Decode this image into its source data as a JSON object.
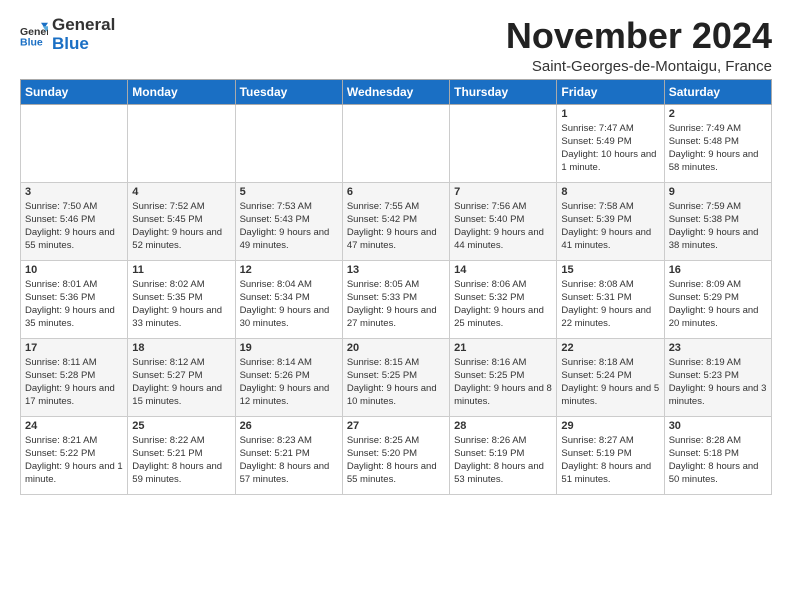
{
  "logo": {
    "general": "General",
    "blue": "Blue"
  },
  "title": "November 2024",
  "location": "Saint-Georges-de-Montaigu, France",
  "headers": [
    "Sunday",
    "Monday",
    "Tuesday",
    "Wednesday",
    "Thursday",
    "Friday",
    "Saturday"
  ],
  "weeks": [
    [
      {
        "day": "",
        "info": ""
      },
      {
        "day": "",
        "info": ""
      },
      {
        "day": "",
        "info": ""
      },
      {
        "day": "",
        "info": ""
      },
      {
        "day": "",
        "info": ""
      },
      {
        "day": "1",
        "info": "Sunrise: 7:47 AM\nSunset: 5:49 PM\nDaylight: 10 hours and 1 minute."
      },
      {
        "day": "2",
        "info": "Sunrise: 7:49 AM\nSunset: 5:48 PM\nDaylight: 9 hours and 58 minutes."
      }
    ],
    [
      {
        "day": "3",
        "info": "Sunrise: 7:50 AM\nSunset: 5:46 PM\nDaylight: 9 hours and 55 minutes."
      },
      {
        "day": "4",
        "info": "Sunrise: 7:52 AM\nSunset: 5:45 PM\nDaylight: 9 hours and 52 minutes."
      },
      {
        "day": "5",
        "info": "Sunrise: 7:53 AM\nSunset: 5:43 PM\nDaylight: 9 hours and 49 minutes."
      },
      {
        "day": "6",
        "info": "Sunrise: 7:55 AM\nSunset: 5:42 PM\nDaylight: 9 hours and 47 minutes."
      },
      {
        "day": "7",
        "info": "Sunrise: 7:56 AM\nSunset: 5:40 PM\nDaylight: 9 hours and 44 minutes."
      },
      {
        "day": "8",
        "info": "Sunrise: 7:58 AM\nSunset: 5:39 PM\nDaylight: 9 hours and 41 minutes."
      },
      {
        "day": "9",
        "info": "Sunrise: 7:59 AM\nSunset: 5:38 PM\nDaylight: 9 hours and 38 minutes."
      }
    ],
    [
      {
        "day": "10",
        "info": "Sunrise: 8:01 AM\nSunset: 5:36 PM\nDaylight: 9 hours and 35 minutes."
      },
      {
        "day": "11",
        "info": "Sunrise: 8:02 AM\nSunset: 5:35 PM\nDaylight: 9 hours and 33 minutes."
      },
      {
        "day": "12",
        "info": "Sunrise: 8:04 AM\nSunset: 5:34 PM\nDaylight: 9 hours and 30 minutes."
      },
      {
        "day": "13",
        "info": "Sunrise: 8:05 AM\nSunset: 5:33 PM\nDaylight: 9 hours and 27 minutes."
      },
      {
        "day": "14",
        "info": "Sunrise: 8:06 AM\nSunset: 5:32 PM\nDaylight: 9 hours and 25 minutes."
      },
      {
        "day": "15",
        "info": "Sunrise: 8:08 AM\nSunset: 5:31 PM\nDaylight: 9 hours and 22 minutes."
      },
      {
        "day": "16",
        "info": "Sunrise: 8:09 AM\nSunset: 5:29 PM\nDaylight: 9 hours and 20 minutes."
      }
    ],
    [
      {
        "day": "17",
        "info": "Sunrise: 8:11 AM\nSunset: 5:28 PM\nDaylight: 9 hours and 17 minutes."
      },
      {
        "day": "18",
        "info": "Sunrise: 8:12 AM\nSunset: 5:27 PM\nDaylight: 9 hours and 15 minutes."
      },
      {
        "day": "19",
        "info": "Sunrise: 8:14 AM\nSunset: 5:26 PM\nDaylight: 9 hours and 12 minutes."
      },
      {
        "day": "20",
        "info": "Sunrise: 8:15 AM\nSunset: 5:25 PM\nDaylight: 9 hours and 10 minutes."
      },
      {
        "day": "21",
        "info": "Sunrise: 8:16 AM\nSunset: 5:25 PM\nDaylight: 9 hours and 8 minutes."
      },
      {
        "day": "22",
        "info": "Sunrise: 8:18 AM\nSunset: 5:24 PM\nDaylight: 9 hours and 5 minutes."
      },
      {
        "day": "23",
        "info": "Sunrise: 8:19 AM\nSunset: 5:23 PM\nDaylight: 9 hours and 3 minutes."
      }
    ],
    [
      {
        "day": "24",
        "info": "Sunrise: 8:21 AM\nSunset: 5:22 PM\nDaylight: 9 hours and 1 minute."
      },
      {
        "day": "25",
        "info": "Sunrise: 8:22 AM\nSunset: 5:21 PM\nDaylight: 8 hours and 59 minutes."
      },
      {
        "day": "26",
        "info": "Sunrise: 8:23 AM\nSunset: 5:21 PM\nDaylight: 8 hours and 57 minutes."
      },
      {
        "day": "27",
        "info": "Sunrise: 8:25 AM\nSunset: 5:20 PM\nDaylight: 8 hours and 55 minutes."
      },
      {
        "day": "28",
        "info": "Sunrise: 8:26 AM\nSunset: 5:19 PM\nDaylight: 8 hours and 53 minutes."
      },
      {
        "day": "29",
        "info": "Sunrise: 8:27 AM\nSunset: 5:19 PM\nDaylight: 8 hours and 51 minutes."
      },
      {
        "day": "30",
        "info": "Sunrise: 8:28 AM\nSunset: 5:18 PM\nDaylight: 8 hours and 50 minutes."
      }
    ]
  ]
}
